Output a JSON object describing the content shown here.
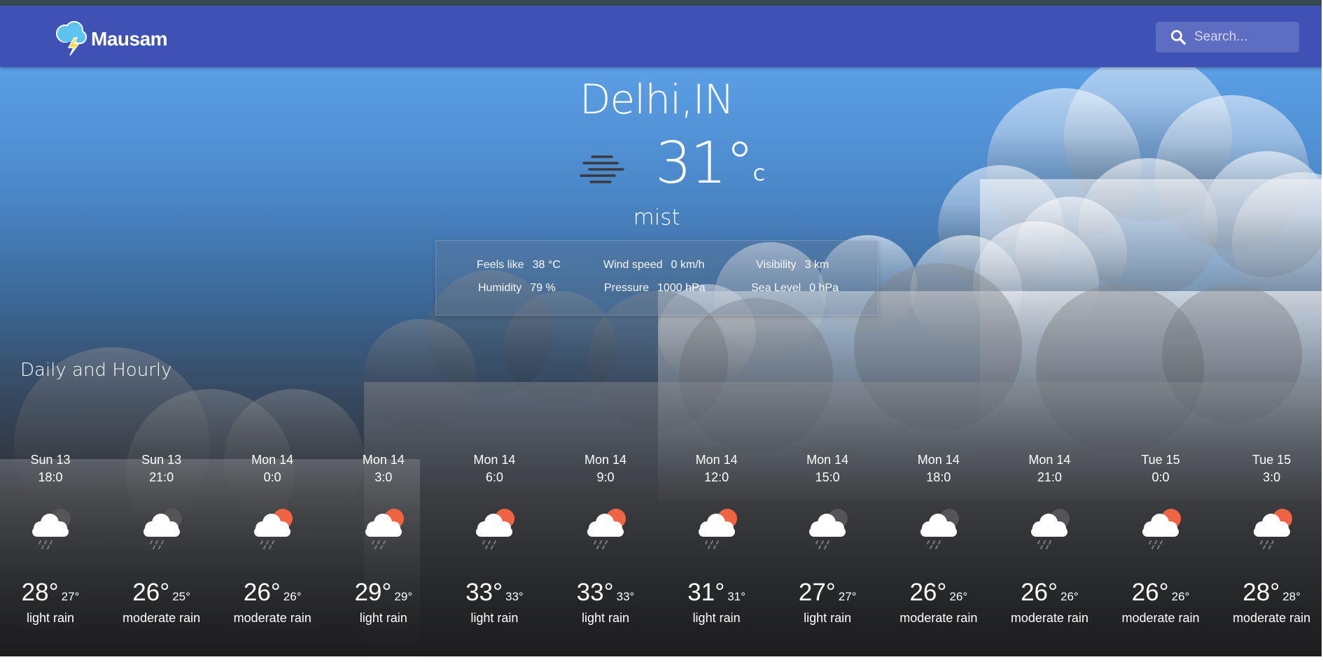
{
  "header": {
    "logo_text": "Mausam",
    "search_placeholder": "Search..."
  },
  "current": {
    "city": "Delhi,IN",
    "temperature": "31°",
    "unit": "C",
    "condition": "mist",
    "icon": "mist-icon",
    "details": {
      "feels_like": {
        "label": "Feels like",
        "value": "38 °C"
      },
      "wind_speed": {
        "label": "Wind speed",
        "value": "0 km/h"
      },
      "visibility": {
        "label": "Visibility",
        "value": "3 km"
      },
      "humidity": {
        "label": "Humidity",
        "value": "79 %"
      },
      "pressure": {
        "label": "Pressure",
        "value": "1000 hPa"
      },
      "sea_level": {
        "label": "Sea Level",
        "value": "0 hPa"
      }
    }
  },
  "forecast": {
    "title": "Daily and Hourly",
    "items": [
      {
        "day": "Sun 13",
        "time": "18:0",
        "temp": "28°",
        "temp_min": "27°",
        "desc": "light rain",
        "icon": "night-rain-icon"
      },
      {
        "day": "Sun 13",
        "time": "21:0",
        "temp": "26°",
        "temp_min": "25°",
        "desc": "moderate rain",
        "icon": "night-rain-icon"
      },
      {
        "day": "Mon 14",
        "time": "0:0",
        "temp": "26°",
        "temp_min": "26°",
        "desc": "moderate rain",
        "icon": "day-rain-icon"
      },
      {
        "day": "Mon 14",
        "time": "3:0",
        "temp": "29°",
        "temp_min": "29°",
        "desc": "light rain",
        "icon": "day-rain-icon"
      },
      {
        "day": "Mon 14",
        "time": "6:0",
        "temp": "33°",
        "temp_min": "33°",
        "desc": "light rain",
        "icon": "day-rain-icon"
      },
      {
        "day": "Mon 14",
        "time": "9:0",
        "temp": "33°",
        "temp_min": "33°",
        "desc": "light rain",
        "icon": "day-rain-icon"
      },
      {
        "day": "Mon 14",
        "time": "12:0",
        "temp": "31°",
        "temp_min": "31°",
        "desc": "light rain",
        "icon": "day-rain-icon"
      },
      {
        "day": "Mon 14",
        "time": "15:0",
        "temp": "27°",
        "temp_min": "27°",
        "desc": "light rain",
        "icon": "night-rain-icon"
      },
      {
        "day": "Mon 14",
        "time": "18:0",
        "temp": "26°",
        "temp_min": "26°",
        "desc": "moderate rain",
        "icon": "night-rain-icon"
      },
      {
        "day": "Mon 14",
        "time": "21:0",
        "temp": "26°",
        "temp_min": "26°",
        "desc": "moderate rain",
        "icon": "night-rain-icon"
      },
      {
        "day": "Tue 15",
        "time": "0:0",
        "temp": "26°",
        "temp_min": "26°",
        "desc": "moderate rain",
        "icon": "day-rain-icon"
      },
      {
        "day": "Tue 15",
        "time": "3:0",
        "temp": "28°",
        "temp_min": "28°",
        "desc": "moderate rain",
        "icon": "day-rain-icon"
      }
    ]
  },
  "colors": {
    "header": "#3f51b5",
    "sun": "#f06443",
    "moon": "#555558",
    "logo_cloud": "#5fc3f0",
    "logo_bolt": "#f8d93a"
  }
}
